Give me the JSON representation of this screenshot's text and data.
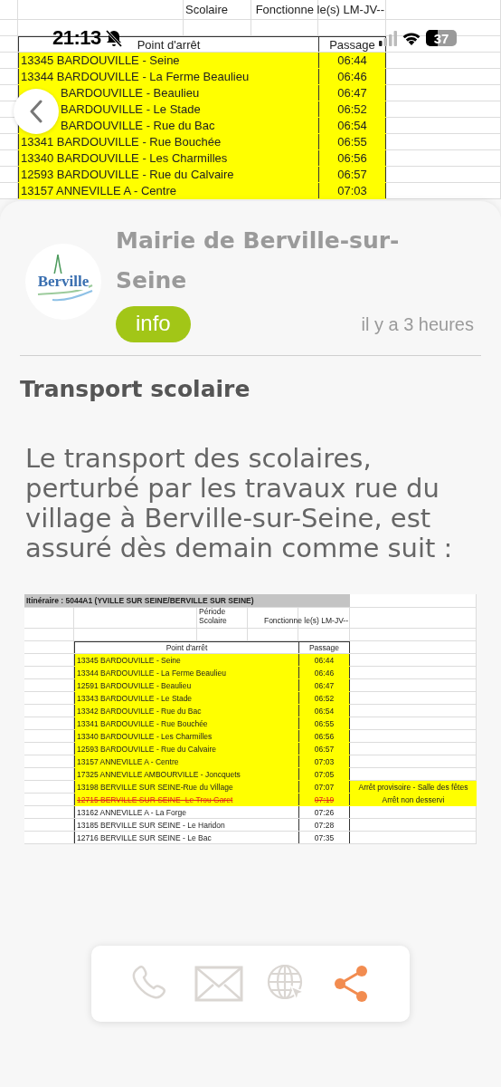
{
  "status_bar": {
    "time": "21:13",
    "battery": "37"
  },
  "header_image": {
    "rows": [
      {
        "kind": "period",
        "label": "Scolaire",
        "value": "Fonctionne le(s) LM-JV--"
      },
      {
        "kind": "blank"
      },
      {
        "kind": "header",
        "stop": "Point d'arrêt",
        "passage": "Passage"
      },
      {
        "kind": "stop",
        "code": "13345",
        "name": "BARDOUVILLE - Seine",
        "passage": "06:44",
        "highlighted": true,
        "struck": false
      },
      {
        "kind": "stop",
        "code": "13344",
        "name": "BARDOUVILLE - La Ferme Beaulieu",
        "passage": "06:46",
        "highlighted": true,
        "struck": false
      },
      {
        "kind": "stop",
        "name": "BARDOUVILLE - Beaulieu",
        "passage": "06:47",
        "highlighted": true,
        "struck": false
      },
      {
        "kind": "stop",
        "name": "BARDOUVILLE - Le Stade",
        "passage": "06:52",
        "highlighted": true,
        "struck": false
      },
      {
        "kind": "stop",
        "name": "BARDOUVILLE - Rue du Bac",
        "passage": "06:54",
        "highlighted": true,
        "struck": false
      },
      {
        "kind": "stop",
        "code": "13341",
        "name": "BARDOUVILLE - Rue Bouchée",
        "passage": "06:55",
        "highlighted": true,
        "struck": false
      },
      {
        "kind": "stop",
        "code": "13340",
        "name": "BARDOUVILLE - Les Charmilles",
        "passage": "06:56",
        "highlighted": true,
        "struck": false
      },
      {
        "kind": "stop",
        "code": "12593",
        "name": "BARDOUVILLE - Rue du Calvaire",
        "passage": "06:57",
        "highlighted": true,
        "struck": false
      },
      {
        "kind": "stop",
        "code": "13157",
        "name": "ANNEVILLE A - Centre",
        "passage": "07:03",
        "highlighted": true,
        "struck": false
      }
    ]
  },
  "post": {
    "publisher": "Mairie de Berville-sur-Seine",
    "logo_text": "Berville",
    "tag": "info",
    "time": "il y a 3 heures",
    "title": "Transport scolaire",
    "body": "Le transport des scolaires, perturbé par les travaux rue du village à Berville-sur-Seine, est assuré dès demain comme suit :",
    "attachment": {
      "rows": [
        {
          "kind": "title",
          "text": "Itinéraire : 5044A1 (YVILLE SUR SEINE/BERVILLE SUR SEINE)"
        },
        {
          "kind": "period",
          "label": "Période Scolaire",
          "value": "Fonctionne le(s) LM-JV--"
        },
        {
          "kind": "blank"
        },
        {
          "kind": "header",
          "stop": "Point d'arrêt",
          "passage": "Passage"
        },
        {
          "kind": "stop",
          "code": "13345",
          "name": "BARDOUVILLE - Seine",
          "passage": "06:44",
          "highlighted": true,
          "struck": false
        },
        {
          "kind": "stop",
          "code": "13344",
          "name": "BARDOUVILLE - La Ferme Beaulieu",
          "passage": "06:46",
          "highlighted": true,
          "struck": false
        },
        {
          "kind": "stop",
          "code": "12591",
          "name": "BARDOUVILLE - Beaulieu",
          "passage": "06:47",
          "highlighted": true,
          "struck": false
        },
        {
          "kind": "stop",
          "code": "13343",
          "name": "BARDOUVILLE - Le Stade",
          "passage": "06:52",
          "highlighted": true,
          "struck": false
        },
        {
          "kind": "stop",
          "code": "13342",
          "name": "BARDOUVILLE - Rue du Bac",
          "passage": "06:54",
          "highlighted": true,
          "struck": false
        },
        {
          "kind": "stop",
          "code": "13341",
          "name": "BARDOUVILLE - Rue Bouchée",
          "passage": "06:55",
          "highlighted": true,
          "struck": false
        },
        {
          "kind": "stop",
          "code": "13340",
          "name": "BARDOUVILLE - Les Charmilles",
          "passage": "06:56",
          "highlighted": true,
          "struck": false
        },
        {
          "kind": "stop",
          "code": "12593",
          "name": "BARDOUVILLE - Rue du Calvaire",
          "passage": "06:57",
          "highlighted": true,
          "struck": false
        },
        {
          "kind": "stop",
          "code": "13157",
          "name": "ANNEVILLE A - Centre",
          "passage": "07:03",
          "highlighted": true,
          "struck": false
        },
        {
          "kind": "stop",
          "code": "17325",
          "name": "ANNEVILLE AMBOURVILLE - Joncquets",
          "passage": "07:05",
          "highlighted": true,
          "struck": false
        },
        {
          "kind": "stop",
          "code": "13198",
          "name": "BERVILLE SUR SEINE-Rue du Village",
          "passage": "07:07",
          "highlighted": true,
          "struck": false,
          "remark": "Arrêt provisoire - Salle des fêtes"
        },
        {
          "kind": "stop",
          "code": "12715",
          "name": "BERVILLE SUR SEINE -Le Trou Garet",
          "passage": "07:19",
          "highlighted": true,
          "struck": true,
          "remark": "Arrêt non desservi"
        },
        {
          "kind": "stop",
          "code": "13162",
          "name": "ANNEVILLE A - La Forge",
          "passage": "07:26",
          "highlighted": false,
          "struck": false
        },
        {
          "kind": "stop",
          "code": "13185",
          "name": "BERVILLE SUR SEINE - Le Haridon",
          "passage": "07:28",
          "highlighted": false,
          "struck": false
        },
        {
          "kind": "stop",
          "code": "12716",
          "name": "BERVILLE SUR SEINE - Le Bac",
          "passage": "07:35",
          "highlighted": false,
          "struck": false
        }
      ]
    }
  },
  "actions": [
    {
      "kind": "phone",
      "enabled": false
    },
    {
      "kind": "mail",
      "enabled": false
    },
    {
      "kind": "web",
      "enabled": false
    },
    {
      "kind": "share",
      "enabled": true
    }
  ]
}
